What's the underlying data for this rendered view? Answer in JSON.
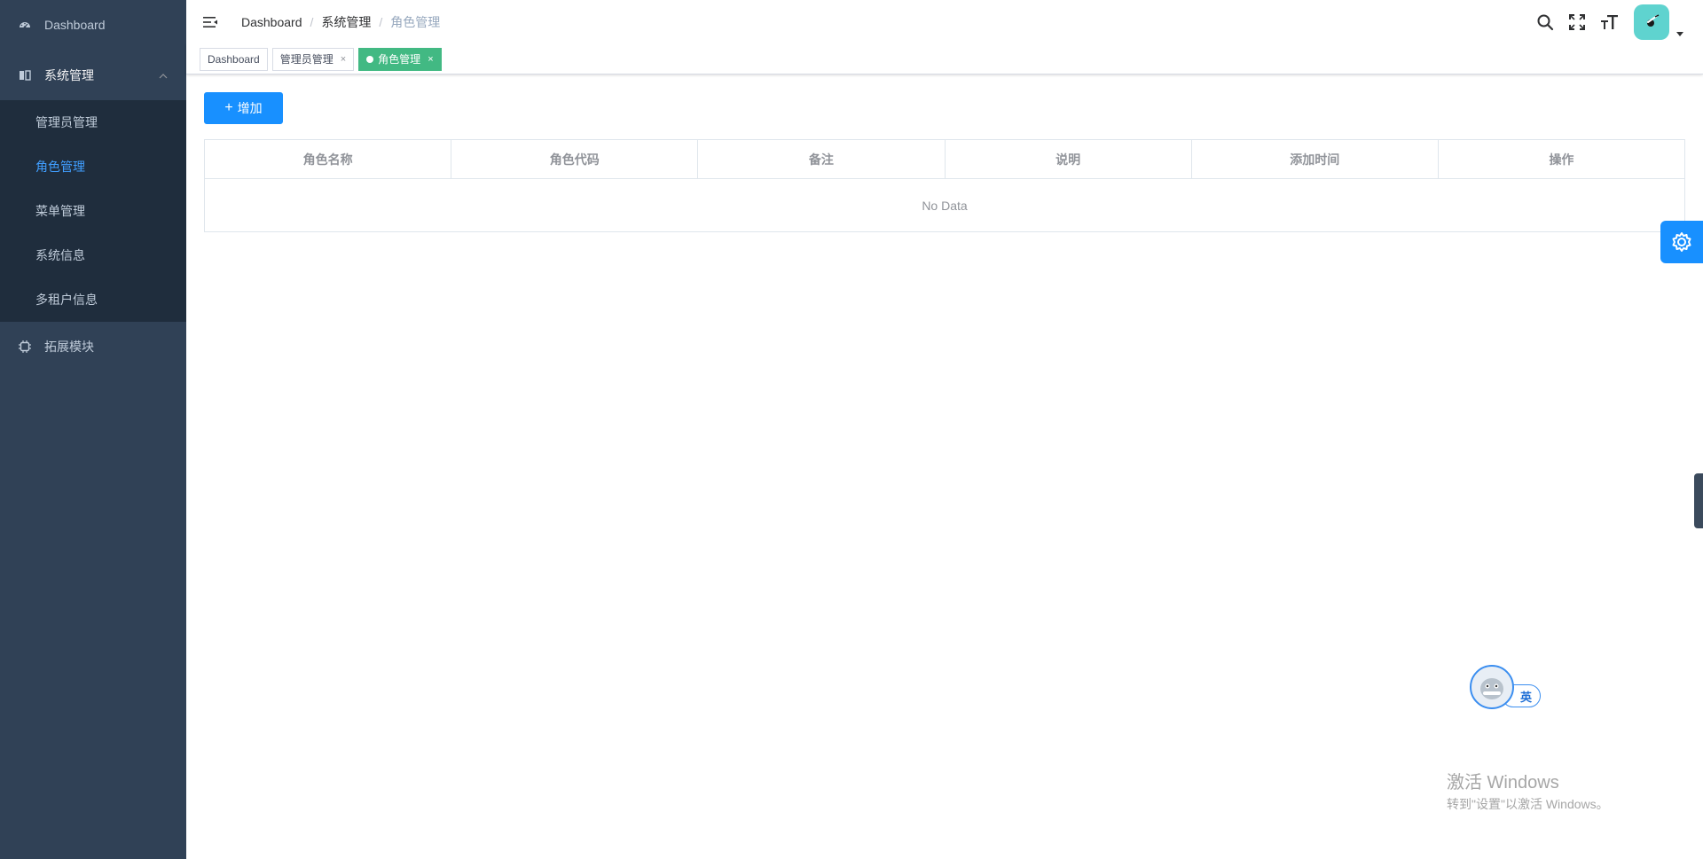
{
  "sidebar": {
    "items": [
      {
        "label": "Dashboard",
        "icon": "dashboard-icon"
      },
      {
        "label": "系统管理",
        "icon": "book-icon",
        "open": true,
        "children": [
          {
            "label": "管理员管理"
          },
          {
            "label": "角色管理",
            "active": true
          },
          {
            "label": "菜单管理"
          },
          {
            "label": "系统信息"
          },
          {
            "label": "多租户信息"
          }
        ]
      },
      {
        "label": "拓展模块",
        "icon": "chip-icon"
      }
    ]
  },
  "header": {
    "breadcrumb": [
      "Dashboard",
      "系统管理",
      "角色管理"
    ],
    "icons": [
      "search-icon",
      "fullscreen-icon",
      "font-size-icon"
    ]
  },
  "tags": [
    {
      "label": "Dashboard"
    },
    {
      "label": "管理员管理",
      "close": "×"
    },
    {
      "label": "角色管理",
      "close": "×",
      "active": true
    }
  ],
  "toolbar": {
    "add_label": "增加",
    "add_icon": "+"
  },
  "table": {
    "columns": [
      "角色名称",
      "角色代码",
      "备注",
      "说明",
      "添加时间",
      "操作"
    ],
    "empty_text": "No Data"
  },
  "ime": {
    "mode": "英"
  },
  "watermark": {
    "title": "激活 Windows",
    "subtitle": "转到\"设置\"以激活 Windows。"
  },
  "colors": {
    "sidebar_bg": "#304156",
    "submenu_bg": "#1f2d3d",
    "active_menu": "#409eff",
    "primary": "#1890ff",
    "tag_active": "#42b983"
  }
}
